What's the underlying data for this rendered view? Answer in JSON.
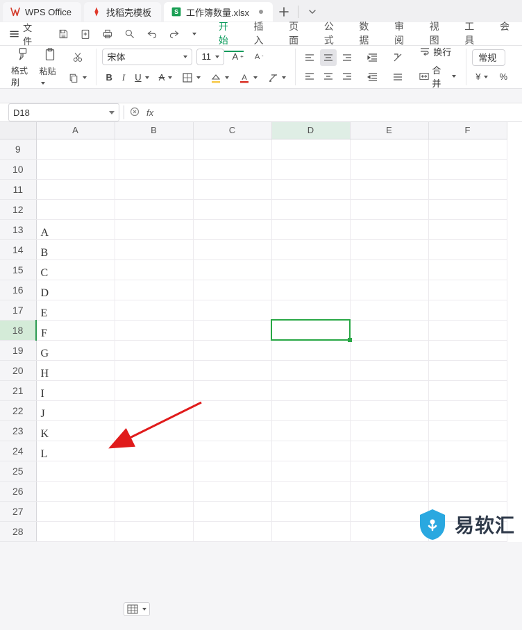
{
  "tabs": {
    "office_label": "WPS Office",
    "template_label": "找稻壳模板",
    "workbook_label": "工作簿数量.xlsx"
  },
  "menu": {
    "file_label": "文件",
    "items": [
      "开始",
      "插入",
      "页面",
      "公式",
      "数据",
      "审阅",
      "视图",
      "工具",
      "会"
    ]
  },
  "ribbon": {
    "brush_label": "格式刷",
    "paste_label": "粘贴",
    "font_name": "宋体",
    "font_size": "11",
    "wrap_label": "换行",
    "merge_label": "合并",
    "num_format": "常规"
  },
  "namebox": "D18",
  "fx_label": "fx",
  "columns": [
    "A",
    "B",
    "C",
    "D",
    "E",
    "F"
  ],
  "rows": [
    "9",
    "10",
    "11",
    "12",
    "13",
    "14",
    "15",
    "16",
    "17",
    "18",
    "19",
    "20",
    "21",
    "22",
    "23",
    "24",
    "25",
    "26",
    "27",
    "28"
  ],
  "colA": {
    "13": "A",
    "14": "B",
    "15": "C",
    "16": "D",
    "17": "E",
    "18": "F",
    "19": "G",
    "20": "H",
    "21": "I",
    "22": "J",
    "23": "K",
    "24": "L"
  },
  "active_cell": "D18",
  "watermark": "易软汇"
}
